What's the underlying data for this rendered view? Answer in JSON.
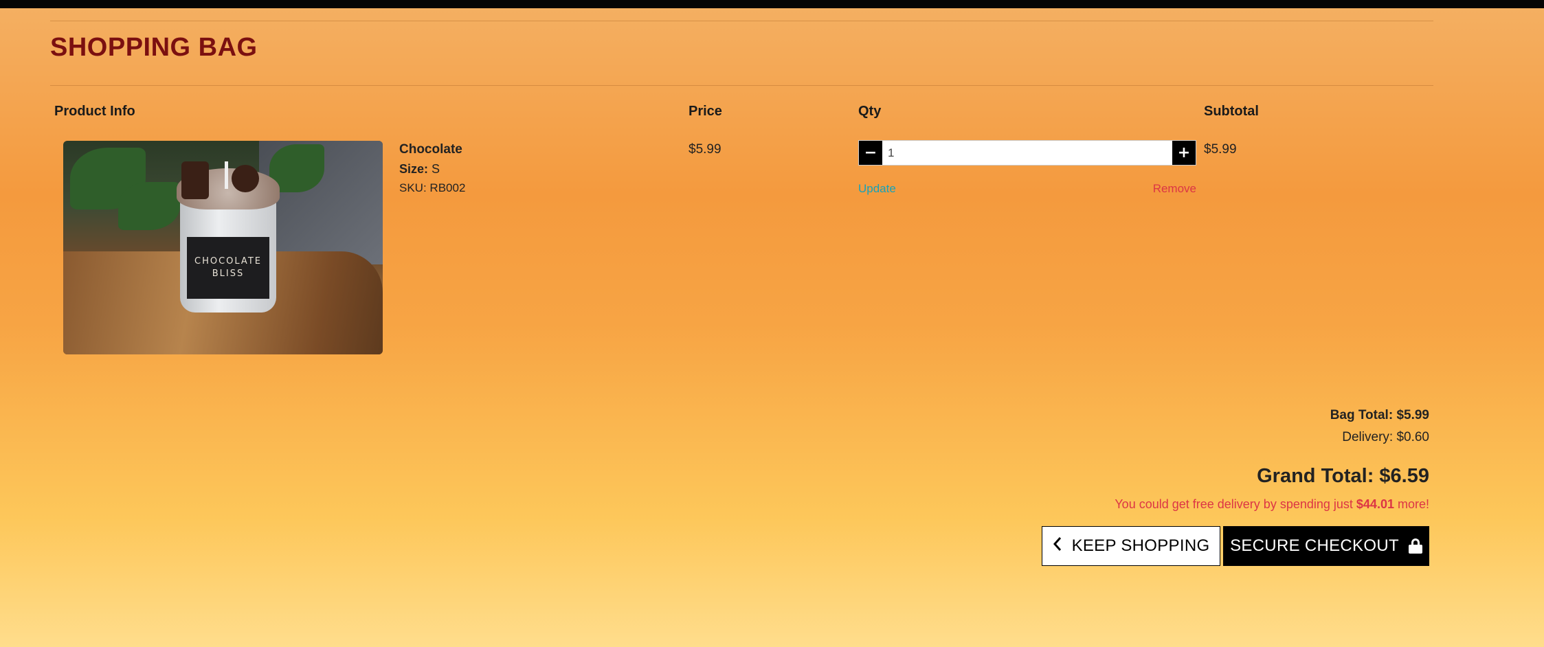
{
  "page": {
    "title": "SHOPPING BAG"
  },
  "table": {
    "headers": {
      "product_info": "Product Info",
      "price": "Price",
      "qty": "Qty",
      "subtotal": "Subtotal"
    },
    "items": [
      {
        "name": "Chocolate",
        "size_label": "Size:",
        "size_value": "S",
        "sku_label": "SKU:",
        "sku_value": "RB002",
        "image_label_line1": "CHOCOLATE",
        "image_label_line2": "BLISS",
        "price": "$5.99",
        "qty": "1",
        "subtotal": "$5.99",
        "update_label": "Update",
        "remove_label": "Remove",
        "decrement_icon": "minus-icon",
        "increment_icon": "plus-icon"
      }
    ]
  },
  "totals": {
    "bag_total_label": "Bag Total:",
    "bag_total_value": "$5.99",
    "delivery_text": "Delivery: $0.60",
    "grand_total_text": "Grand Total: $6.59",
    "free_delivery_prefix": "You could get free delivery by spending just",
    "free_delivery_amount": "$44.01",
    "free_delivery_suffix": "more!"
  },
  "actions": {
    "keep_shopping_label": "KEEP SHOPPING",
    "keep_shopping_icon": "chevron-left-icon",
    "checkout_label": "SECURE CHECKOUT",
    "checkout_icon": "lock-icon"
  },
  "colors": {
    "title": "#7b1010",
    "update_link": "#17a2b8",
    "remove_link": "#dc3545",
    "free_note": "#dc3545"
  }
}
